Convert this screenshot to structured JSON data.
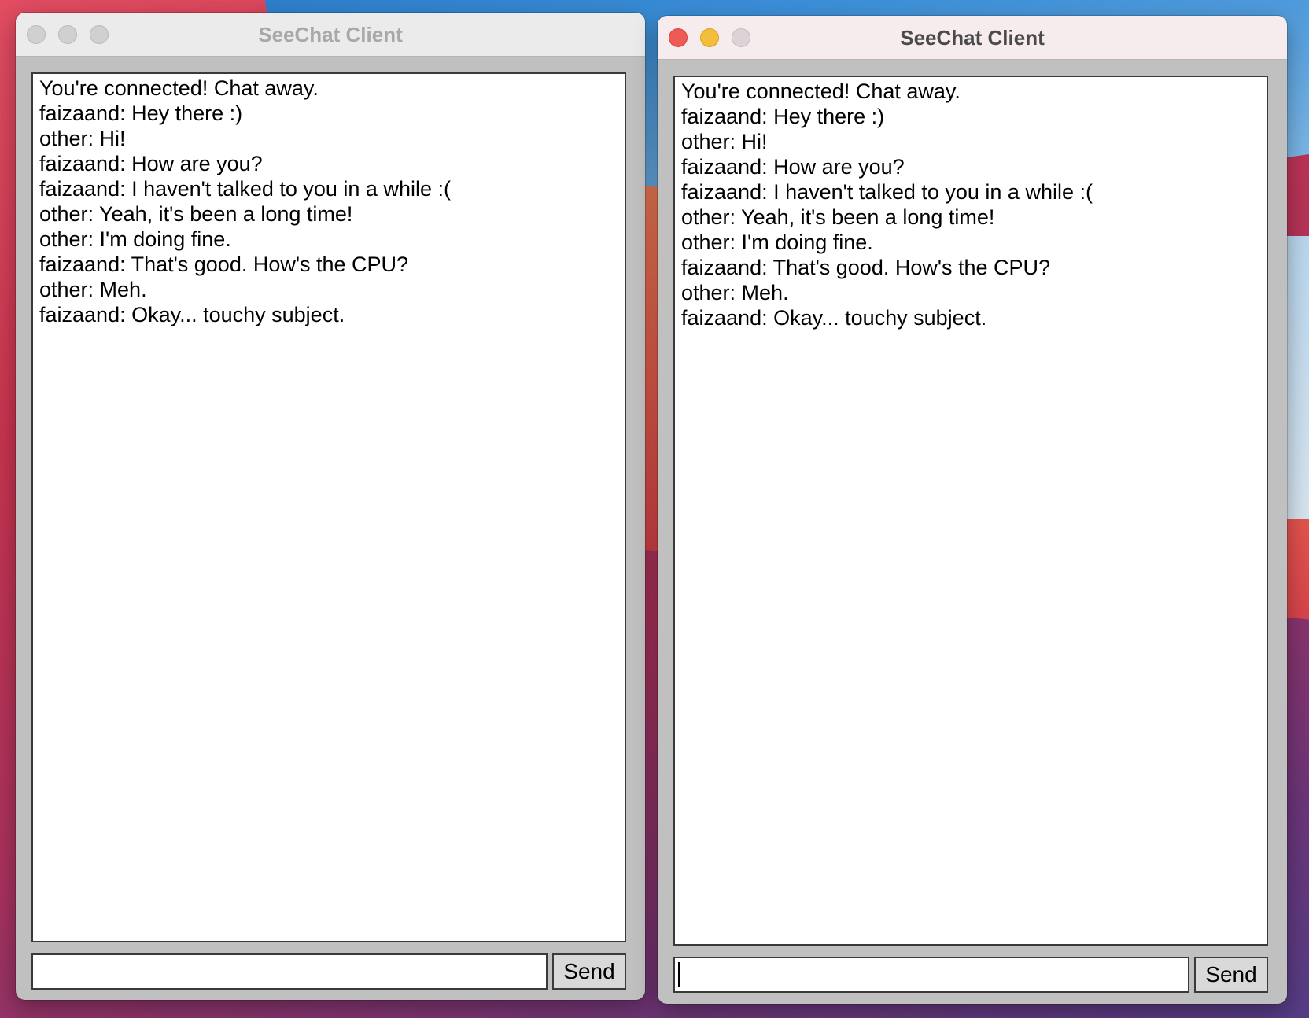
{
  "windows": [
    {
      "title": "SeeChat Client",
      "active": false,
      "messages": [
        "You're connected! Chat away.",
        "faizaand: Hey there :)",
        "other: Hi!",
        "faizaand: How are you?",
        "faizaand: I haven't talked to you in a while :(",
        "other: Yeah, it's been a long time!",
        "other: I'm doing fine.",
        "faizaand: That's good. How's the CPU?",
        "other: Meh.",
        "faizaand: Okay... touchy subject."
      ],
      "input_value": "",
      "send_label": "Send"
    },
    {
      "title": "SeeChat Client",
      "active": true,
      "messages": [
        "You're connected! Chat away.",
        "faizaand: Hey there :)",
        "other: Hi!",
        "faizaand: How are you?",
        "faizaand: I haven't talked to you in a while :(",
        "other: Yeah, it's been a long time!",
        "other: I'm doing fine.",
        "faizaand: That's good. How's the CPU?",
        "other: Meh.",
        "faizaand: Okay... touchy subject."
      ],
      "input_value": "",
      "send_label": "Send"
    }
  ],
  "colors": {
    "window_gray": "#c0c0c0",
    "close_active": "#ee5b55",
    "minimize_active": "#f4bd3b"
  }
}
